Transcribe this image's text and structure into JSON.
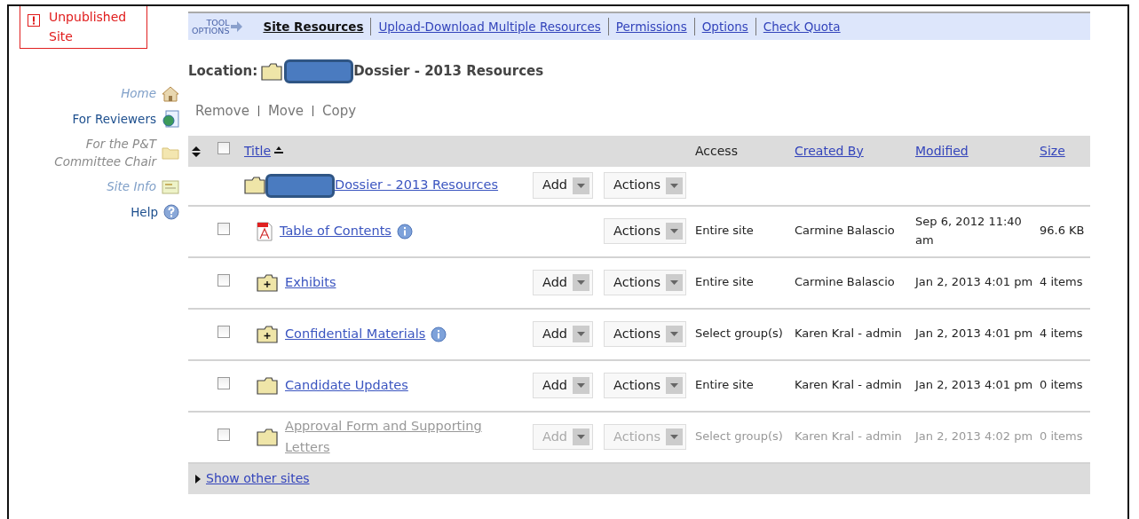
{
  "notice": {
    "text": "Unpublished Site"
  },
  "sidebar": {
    "items": [
      {
        "label": "Home",
        "kind": "faded"
      },
      {
        "label": "For Reviewers",
        "kind": "link"
      },
      {
        "label": "For the P&T Committee Chair",
        "kind": "muted"
      },
      {
        "label": "Site Info",
        "kind": "faded"
      },
      {
        "label": "Help",
        "kind": "link"
      }
    ]
  },
  "toolbar": {
    "label_lines": [
      "TOOL",
      "OPTIONS"
    ],
    "items": [
      {
        "label": "Site Resources",
        "selected": true
      },
      {
        "label": "Upload-Download Multiple Resources",
        "selected": false
      },
      {
        "label": "Permissions",
        "selected": false
      },
      {
        "label": "Options",
        "selected": false
      },
      {
        "label": "Check Quota",
        "selected": false
      }
    ]
  },
  "location": {
    "label": "Location:",
    "path": "Dossier - 2013 Resources",
    "redacted": true
  },
  "actions": [
    "Remove",
    "Move",
    "Copy"
  ],
  "table": {
    "header_checkbox": {
      "checked": false
    },
    "columns": [
      {
        "label": "Title",
        "link": true,
        "sorted": true
      },
      {
        "label": "Access",
        "link": false,
        "sorted": false
      },
      {
        "label": "Created By",
        "link": true,
        "sorted": false
      },
      {
        "label": "Modified",
        "link": true,
        "sorted": false
      },
      {
        "label": "Size",
        "link": true,
        "sorted": false
      }
    ],
    "parent": {
      "title": "Dossier - 2013 Resources",
      "redacted": true,
      "add": "Add",
      "actions": "Actions"
    },
    "rows": [
      {
        "kind": "file",
        "title": "Table of Contents",
        "info": true,
        "actions": "Actions",
        "access": "Entire site",
        "created_by": "Carmine Balascio",
        "modified": "Sep 6, 2012 11:40 am",
        "size": "96.6 KB",
        "checked": false,
        "disabled": false
      },
      {
        "kind": "expandable",
        "title": "Exhibits",
        "info": false,
        "add": "Add",
        "actions": "Actions",
        "access": "Entire site",
        "created_by": "Carmine Balascio",
        "modified": "Jan 2, 2013 4:01 pm",
        "size": "4 items",
        "checked": false,
        "disabled": false
      },
      {
        "kind": "expandable",
        "title": "Confidential Materials",
        "info": true,
        "add": "Add",
        "actions": "Actions",
        "access": "Select group(s)",
        "created_by": "Karen Kral - admin",
        "modified": "Jan 2, 2013 4:01 pm",
        "size": "4 items",
        "checked": false,
        "disabled": false
      },
      {
        "kind": "folder",
        "title": "Candidate Updates",
        "info": false,
        "add": "Add",
        "actions": "Actions",
        "access": "Entire site",
        "created_by": "Karen Kral - admin",
        "modified": "Jan 2, 2013 4:01 pm",
        "size": "0 items",
        "checked": false,
        "disabled": false
      },
      {
        "kind": "folder",
        "title": "Approval Form and Supporting Letters",
        "info": false,
        "add": "Add",
        "actions": "Actions",
        "access": "Select group(s)",
        "created_by": "Karen Kral - admin",
        "modified": "Jan 2, 2013 4:02 pm",
        "size": "0 items",
        "checked": false,
        "disabled": true
      }
    ]
  },
  "footer": {
    "link": "Show other sites"
  }
}
